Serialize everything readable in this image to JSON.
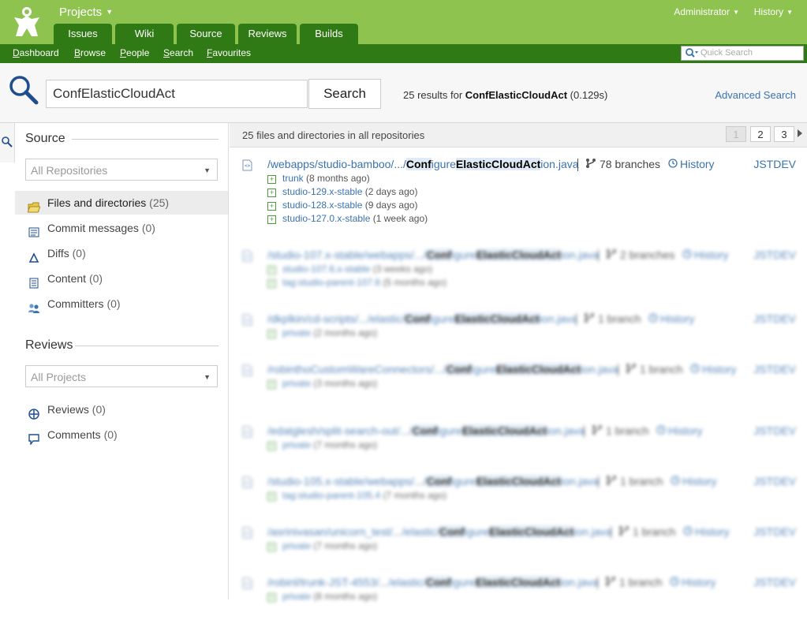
{
  "header": {
    "projects_label": "Projects",
    "tabs": [
      {
        "label": "Issues"
      },
      {
        "label": "Wiki"
      },
      {
        "label": "Source"
      },
      {
        "label": "Reviews"
      },
      {
        "label": "Builds"
      }
    ],
    "admin_label": "Administrator",
    "history_label": "History",
    "subnav": [
      {
        "u": "D",
        "rest": "ashboard"
      },
      {
        "u": "B",
        "rest": "rowse"
      },
      {
        "u": "P",
        "rest": "eople"
      },
      {
        "u": "S",
        "rest": "earch"
      },
      {
        "u": "F",
        "rest": "avourites"
      }
    ],
    "quick_search_placeholder": "Quick Search"
  },
  "search": {
    "query": "ConfElasticCloudAct",
    "button_label": "Search",
    "results_prefix": "25 results for ",
    "results_query": "ConfElasticCloudAct",
    "results_time": " (0.129s)",
    "advanced_label": "Advanced Search"
  },
  "sidebar": {
    "source_heading": "Source",
    "repo_dropdown": "All Repositories",
    "source_items": [
      {
        "label": "Files and directories",
        "count": "(25)",
        "selected": true
      },
      {
        "label": "Commit messages",
        "count": "(0)"
      },
      {
        "label": "Diffs",
        "count": "(0)"
      },
      {
        "label": "Content",
        "count": "(0)"
      },
      {
        "label": "Committers",
        "count": "(0)"
      }
    ],
    "reviews_heading": "Reviews",
    "project_dropdown": "All Projects",
    "review_items": [
      {
        "label": "Reviews",
        "count": "(0)"
      },
      {
        "label": "Comments",
        "count": "(0)"
      }
    ]
  },
  "results": {
    "header_text": "25 files and directories in all repositories",
    "pages": [
      "1",
      "2",
      "3"
    ],
    "current_page": "1",
    "items": [
      {
        "path_prefix": "/webapps/studio-bamboo/.../",
        "path_conf": "Conf",
        "path_mid": "igure",
        "path_elastic": "ElasticCloudAct",
        "path_suffix": "ion.java",
        "branches": "78 branches",
        "history": "History",
        "project": "JSTDEV",
        "branch_lines": [
          {
            "name": "trunk",
            "ago": "(8 months ago)"
          },
          {
            "name": "studio-129.x-stable",
            "ago": "(2 days ago)"
          },
          {
            "name": "studio-128.x-stable",
            "ago": "(9 days ago)"
          },
          {
            "name": "studio-127.0.x-stable",
            "ago": "(1 week ago)"
          }
        ]
      },
      {
        "path_prefix": "/studio-107.x-stable/webapps/.../",
        "path_conf": "Conf",
        "path_mid": "igure",
        "path_elastic": "ElasticCloudAct",
        "path_suffix": "ion.java",
        "branches": "2 branches",
        "history": "History",
        "project": "JSTDEV",
        "branch_lines": [
          {
            "name": "studio-107.6.x-stable",
            "ago": "(3 weeks ago)"
          },
          {
            "name": "tag:studio-parent-107.6",
            "ago": "(5 months ago)"
          }
        ]
      },
      {
        "path_prefix": "/dkplkin/cd-scripts/.../elastic/",
        "path_conf": "Conf",
        "path_mid": "igure",
        "path_elastic": "ElasticCloudAct",
        "path_suffix": "ion.java",
        "branches": "1 branch",
        "history": "History",
        "project": "JSTDEV",
        "branch_lines": [
          {
            "name": "private",
            "ago": "(2 months ago)"
          }
        ]
      },
      {
        "path_prefix": "/robinthoCustomWareConnectors/.../",
        "path_conf": "Conf",
        "path_mid": "igure",
        "path_elastic": "ElasticCloudAct",
        "path_suffix": "ion.java",
        "branches": "1 branch",
        "history": "History",
        "project": "JSTDEV",
        "branch_lines": [
          {
            "name": "private",
            "ago": "(3 months ago)"
          }
        ]
      },
      {
        "path_prefix": "/edatglesh/split-search-out/.../",
        "path_conf": "Conf",
        "path_mid": "igure",
        "path_elastic": "ElasticCloudAct",
        "path_suffix": "ion.java",
        "branches": "1 branch",
        "history": "History",
        "project": "JSTDEV",
        "branch_lines": [
          {
            "name": "private",
            "ago": "(7 months ago)"
          }
        ]
      },
      {
        "path_prefix": "/studio-105.x-stable/webapps/.../",
        "path_conf": "Conf",
        "path_mid": "igure",
        "path_elastic": "ElasticCloudAct",
        "path_suffix": "ion.java",
        "branches": "1 branch",
        "history": "History",
        "project": "JSTDEV",
        "branch_lines": [
          {
            "name": "tag:studio-parent-105.4",
            "ago": "(7 months ago)"
          }
        ]
      },
      {
        "path_prefix": "/asrinivasan/unicorn_test/.../elastic/",
        "path_conf": "Conf",
        "path_mid": "igure",
        "path_elastic": "ElasticCloudAct",
        "path_suffix": "ion.java",
        "branches": "1 branch",
        "history": "History",
        "project": "JSTDEV",
        "branch_lines": [
          {
            "name": "private",
            "ago": "(7 months ago)"
          }
        ]
      },
      {
        "path_prefix": "/robinl/trunk-JST-4553/.../elastic/",
        "path_conf": "Conf",
        "path_mid": "igure",
        "path_elastic": "ElasticCloudAct",
        "path_suffix": "ion.java",
        "branches": "1 branch",
        "history": "History",
        "project": "JSTDEV",
        "branch_lines": [
          {
            "name": "private",
            "ago": "(8 months ago)"
          }
        ]
      }
    ]
  },
  "colors": {
    "header_green": "#8ec350",
    "tab_green": "#2f7a14",
    "link_blue": "#3b73af"
  }
}
